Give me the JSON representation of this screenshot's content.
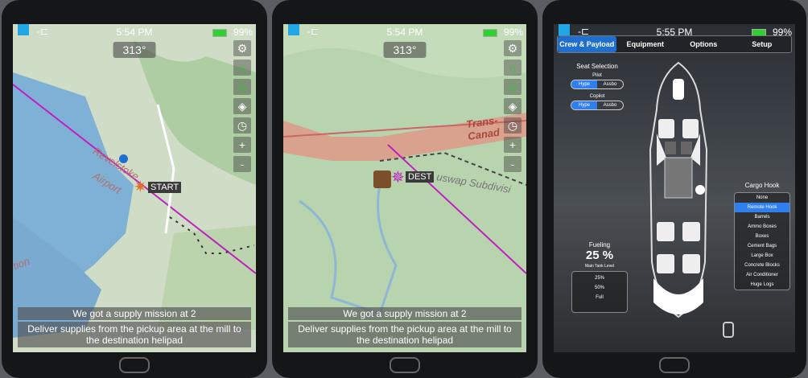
{
  "colors": {
    "accent": "#2f7ff0",
    "battery": "#2ed12e",
    "route": "#c020c0",
    "active_icon": "#28d028"
  },
  "tablets": [
    {
      "time": "5:54 PM",
      "battery": "99%",
      "heading": "313°",
      "pin_label": "START",
      "map_labels": [
        "Revelstoke",
        "Airport",
        "tion"
      ],
      "mission_title": "We got a supply mission at 2",
      "mission_desc": "Deliver supplies from the pickup area at the mill to the destination helipad",
      "toolbar": [
        "gear-icon",
        "bank-icon",
        "pilot-icon",
        "layers-icon",
        "clock-icon",
        "zoom-in-icon",
        "zoom-out-icon"
      ],
      "zoom_in": "+",
      "zoom_out": "-"
    },
    {
      "time": "5:54 PM",
      "battery": "99%",
      "heading": "313°",
      "pin_label": "DEST",
      "map_labels": [
        "Trans-Canad",
        "uswap Subdivisi"
      ],
      "mission_title": "We got a supply mission at 2",
      "mission_desc": "Deliver supplies from the pickup area at the mill to the destination helipad",
      "toolbar": [
        "gear-icon",
        "bank-icon",
        "pilot-icon",
        "layers-icon",
        "clock-icon",
        "zoom-in-icon",
        "zoom-out-icon"
      ],
      "zoom_in": "+",
      "zoom_out": "-"
    },
    {
      "time": "5:55 PM",
      "battery": "99%",
      "tabs": [
        "Crew & Payload",
        "Equipment",
        "Options",
        "Setup"
      ],
      "seat_selection": {
        "title": "Seat Selection",
        "pilot_label": "Pilot",
        "copilot_label": "Copilot",
        "options": [
          "Hype",
          "Assbo"
        ]
      },
      "fueling": {
        "title": "Fueling",
        "value": "25 %",
        "tank_label": "Main Tank Level",
        "options": [
          "25%",
          "50%",
          "Full"
        ]
      },
      "cargo_hook": {
        "title": "Cargo Hook",
        "options": [
          "None",
          "Remote Hook",
          "Barrels",
          "Ammo Boxes",
          "Boxes",
          "Cement Bags",
          "Large Box",
          "Concrete Blocks",
          "Air Conditioner",
          "Huge Logs"
        ],
        "selected": "Remote Hook"
      }
    }
  ]
}
